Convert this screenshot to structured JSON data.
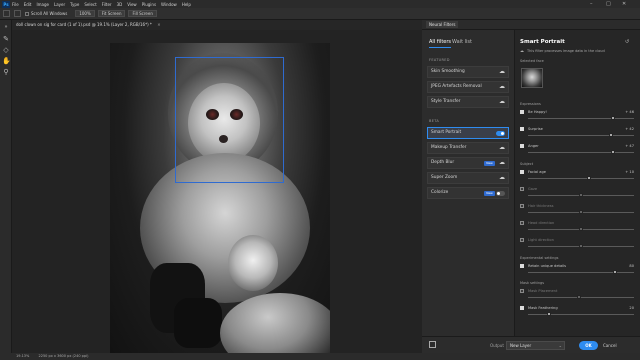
{
  "app": {
    "menus": [
      "Ps",
      "File",
      "Edit",
      "Image",
      "Layer",
      "Type",
      "Select",
      "Filter",
      "3D",
      "View",
      "Plugins",
      "Window",
      "Help"
    ]
  },
  "options_bar": {
    "scroll_all": "Scroll All Windows",
    "zoom": "100%",
    "fit_screen": "Fit Screen",
    "fill_screen": "Fill Screen"
  },
  "document": {
    "tab_title": "doll clown on sig for card (1 of 1).psd @ 19.1% (Layer 2, RGB/16*) *",
    "zoom_status": "19.13%",
    "size_status": "2250 px x 3600 px (240 ppi)"
  },
  "neural_filters": {
    "strip_label": "Neural Filters",
    "tabs": [
      "All filters",
      "Wait list"
    ],
    "featured_label": "FEATURED",
    "beta_label": "BETA",
    "featured": [
      "Skin Smoothing",
      "JPEG Artefacts Removal",
      "Style Transfer"
    ],
    "beta": [
      "Smart Portrait",
      "Makeup Transfer",
      "Depth Blur",
      "Super Zoom",
      "Colorize"
    ],
    "badge_new": "New"
  },
  "detail": {
    "title": "Smart Portrait",
    "description": "This filter processes image data in the cloud",
    "selected_face_label": "Selected face",
    "expressions_label": "Expressions",
    "subject_label": "Subject",
    "experimental_label": "Experimental settings",
    "mask_label": "Mask settings",
    "sliders": [
      {
        "name": "Be Happy!",
        "value": "+ 46",
        "level": 0.8,
        "on": true
      },
      {
        "name": "Surprise",
        "value": "+ 42",
        "level": 0.78,
        "on": true
      },
      {
        "name": "Anger",
        "value": "+ 47",
        "level": 0.8,
        "on": true
      },
      {
        "name": "Facial age",
        "value": "+ 10",
        "level": 0.58,
        "on": true
      },
      {
        "name": "Gaze",
        "value": "",
        "level": 0.5,
        "on": false
      },
      {
        "name": "Hair thickness",
        "value": "",
        "level": 0.5,
        "on": false
      },
      {
        "name": "Head direction",
        "value": "",
        "level": 0.5,
        "on": false
      },
      {
        "name": "Light direction",
        "value": "",
        "level": 0.5,
        "on": false
      },
      {
        "name": "Retain unique details",
        "value": "80",
        "level": 0.82,
        "on": true
      },
      {
        "name": "Mask Placement",
        "value": "",
        "level": 0.48,
        "on": false
      },
      {
        "name": "Mask Feathering",
        "value": "20",
        "level": 0.2,
        "on": true
      }
    ]
  },
  "actions": {
    "output_label": "Output",
    "output_value": "New Layer",
    "ok": "OK",
    "cancel": "Cancel"
  }
}
